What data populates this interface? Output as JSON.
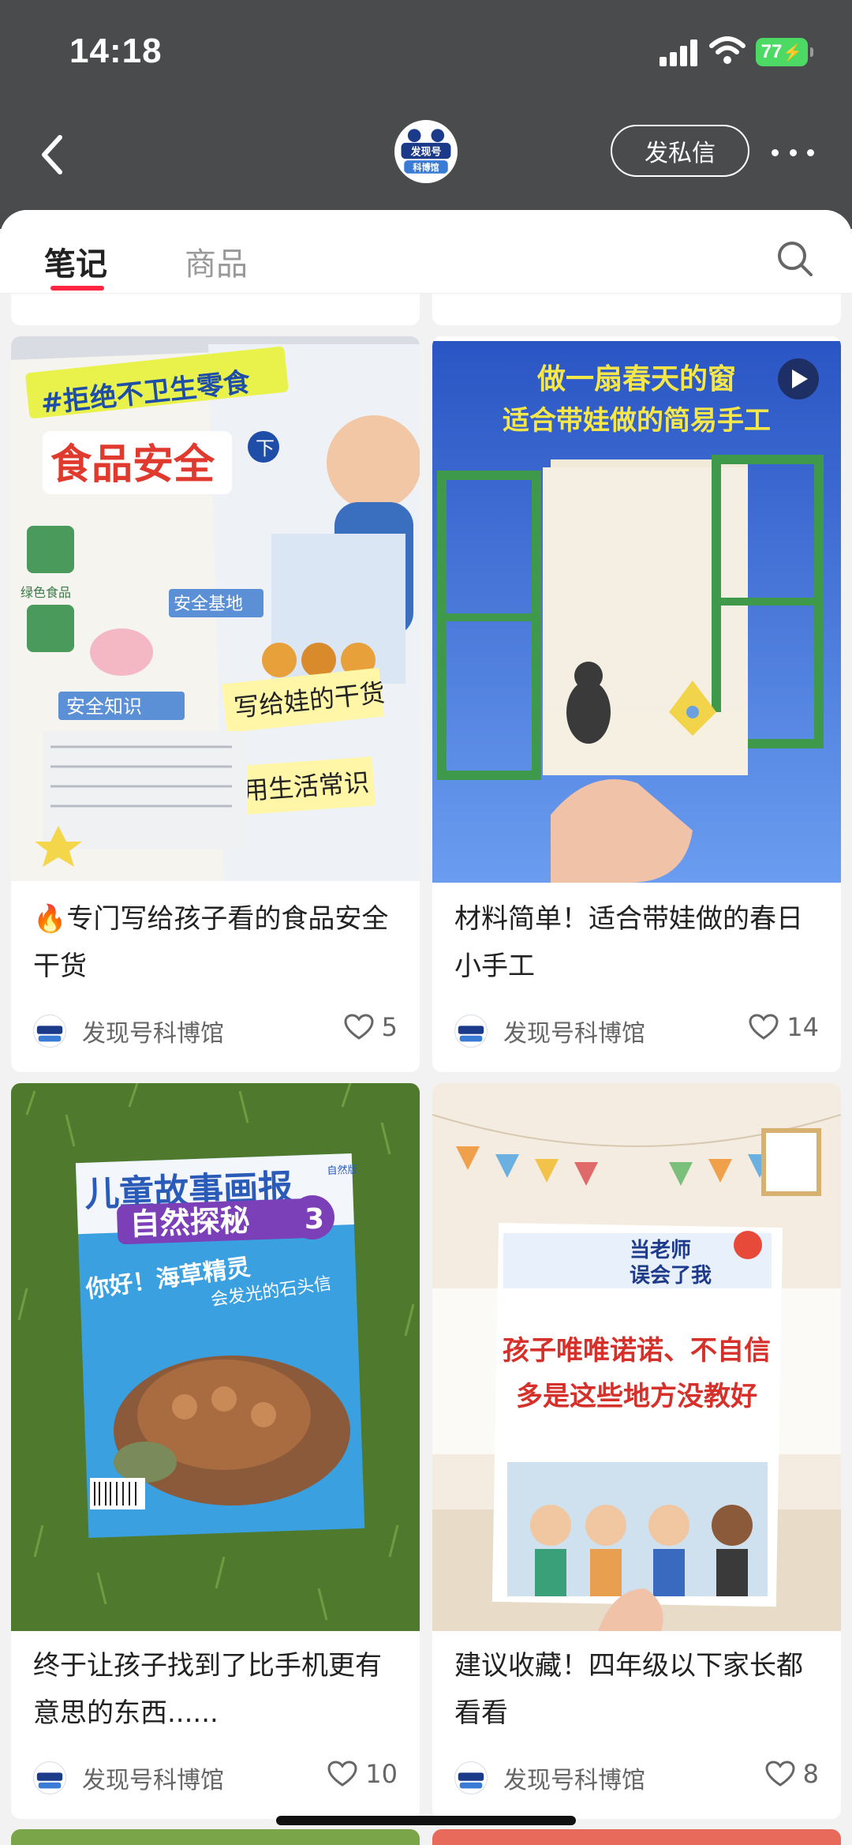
{
  "status_bar": {
    "time": "14:18",
    "battery": "77"
  },
  "header": {
    "dm_button": "发私信",
    "avatar_text": "发现号科博馆"
  },
  "tabs": [
    {
      "label": "笔记",
      "active": true
    },
    {
      "label": "商品",
      "active": false
    }
  ],
  "icons": {
    "search": "search-icon",
    "back": "chevron-left-icon",
    "more": "more-dots-icon",
    "like": "heart-icon",
    "video": "play-icon",
    "fire": "fire-emoji"
  },
  "notes": [
    {
      "title": "专门写给孩子看的食品安全干货",
      "title_prefix": "🔥",
      "author": "发现号科博馆",
      "likes": "5",
      "cover": {
        "banner": "#拒绝不卫生零食",
        "heading": "食品安全",
        "badge": "下",
        "sticker1": "写给娃的干货",
        "sticker2": "实用生活常识",
        "section1": "安全基地",
        "section2": "安全知识",
        "label_green": "绿色食品"
      }
    },
    {
      "title": "材料简单！适合带娃做的春日小手工",
      "author": "发现号科博馆",
      "likes": "14",
      "is_video": true,
      "cover": {
        "line1": "做一扇春天的窗",
        "line2": "适合带娃做的简易手工"
      }
    },
    {
      "title": "终于让孩子找到了比手机更有意思的东西......",
      "author": "发现号科博馆",
      "likes": "10",
      "cover": {
        "mag_title": "儿童故事画报",
        "mag_edition": "自然版",
        "mag_sub": "自然探秘",
        "mag_issue": "3",
        "mag_tag": "你好！海草精灵",
        "mag_tag2": "会发光的石头信"
      }
    },
    {
      "title": "建议收藏！四年级以下家长都看看",
      "author": "发现号科博馆",
      "likes": "8",
      "cover": {
        "comic_title1": "当老师",
        "comic_title2": "误会了我",
        "overlay1": "孩子唯唯诺诺、不自信",
        "overlay2": "多是这些地方没教好"
      }
    }
  ],
  "colors": {
    "accent": "#ff2442",
    "topbar": "#4a4b4d",
    "battery": "#4cd964"
  }
}
